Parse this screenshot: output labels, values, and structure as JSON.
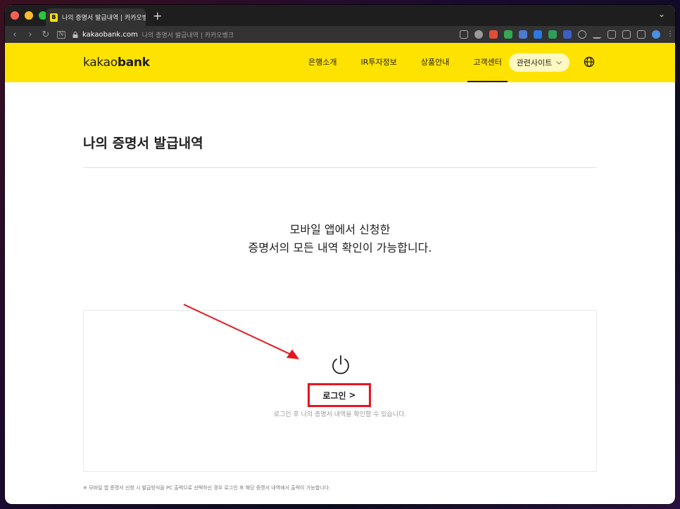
{
  "browser": {
    "tab_title": "나의 증명서 발급내역 | 카카오뱅크",
    "favicon_letter": "B",
    "new_tab": "+",
    "url_domain": "kakaobank.com",
    "url_title": "나의 증명서 발급내역 | 카카오뱅크"
  },
  "header": {
    "logo_light": "kakao",
    "logo_bold": "bank",
    "nav": [
      "은행소개",
      "IR투자정보",
      "상품안내",
      "고객센터"
    ],
    "active_nav": "고객센터",
    "related_sites": "관련사이트",
    "brand_color": "#ffe300"
  },
  "main": {
    "title": "나의 증명서 발급내역",
    "lead_line1": "모바일 앱에서 신청한",
    "lead_line2": "증명서의 모든 내역 확인이 가능합니다.",
    "login_label": "로그인",
    "login_chevron": ">",
    "login_desc": "로그인 후 나의 증명서 내역을 확인할 수 있습니다.",
    "footnote": "※ 모바일 앱 증명서 신청 시 발급방식을 PC 출력으로 선택하신 경우 로그인 후 해당 증명서 내역에서 출력이 가능합니다.",
    "highlight_color": "#e8141e"
  },
  "icons": [
    "power-icon",
    "globe-icon",
    "chevron-down-icon",
    "lock-icon"
  ]
}
